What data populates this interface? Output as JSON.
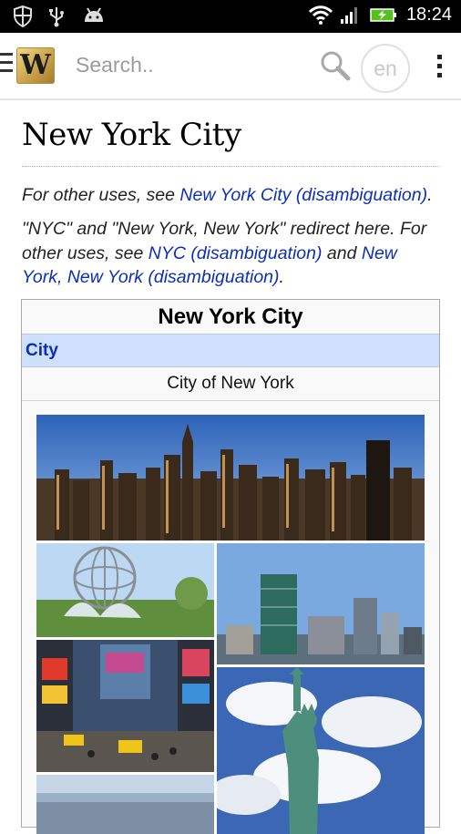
{
  "status_bar": {
    "time": "18:24",
    "icons": [
      "shield-icon",
      "usb-icon",
      "android-icon",
      "wifi-icon",
      "signal-icon",
      "battery-charging-icon"
    ]
  },
  "toolbar": {
    "logo_letter": "W",
    "search_placeholder": "Search..",
    "language": "en"
  },
  "article": {
    "title": "New York City",
    "hatnote1": {
      "prefix": "For other uses, see ",
      "link": "New York City (disambiguation)",
      "suffix": "."
    },
    "hatnote2": {
      "prefix": "\"NYC\" and \"New York, New York\" redirect here. For other uses, see ",
      "link1": "NYC (disambiguation)",
      "middle": " and ",
      "link2": "New York, New York (disambiguation)",
      "suffix": "."
    },
    "infobox": {
      "title": "New York City",
      "type": "City",
      "official_name": "City of New York"
    }
  },
  "colors": {
    "link": "#0b2fb5",
    "infobox_header": "#cfe0ff",
    "statusbar": "#000000"
  }
}
